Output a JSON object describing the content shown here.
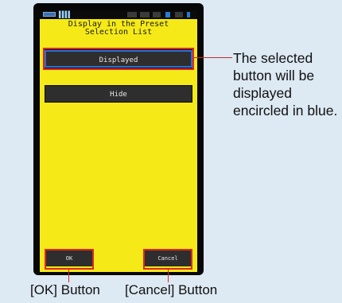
{
  "screen": {
    "title_line1": "Display in the Preset",
    "title_line2": "Selection List",
    "statusbar": {
      "signal_text": "▌▌▌▌"
    },
    "options": [
      {
        "label": "Displayed",
        "selected": true
      },
      {
        "label": "Hide",
        "selected": false
      }
    ],
    "ok_label": "OK",
    "cancel_label": "Cancel"
  },
  "annotations": {
    "selected_note": "The selected button will be displayed encircled in blue.",
    "ok_caption": "[OK] Button",
    "cancel_caption": "[Cancel] Button"
  },
  "colors": {
    "screen_bg": "#f5ea17",
    "button_bg": "#2e2e2e",
    "highlight_red": "#e0262b",
    "selected_blue": "#2b6fd6",
    "page_bg": "#dde9f3"
  }
}
